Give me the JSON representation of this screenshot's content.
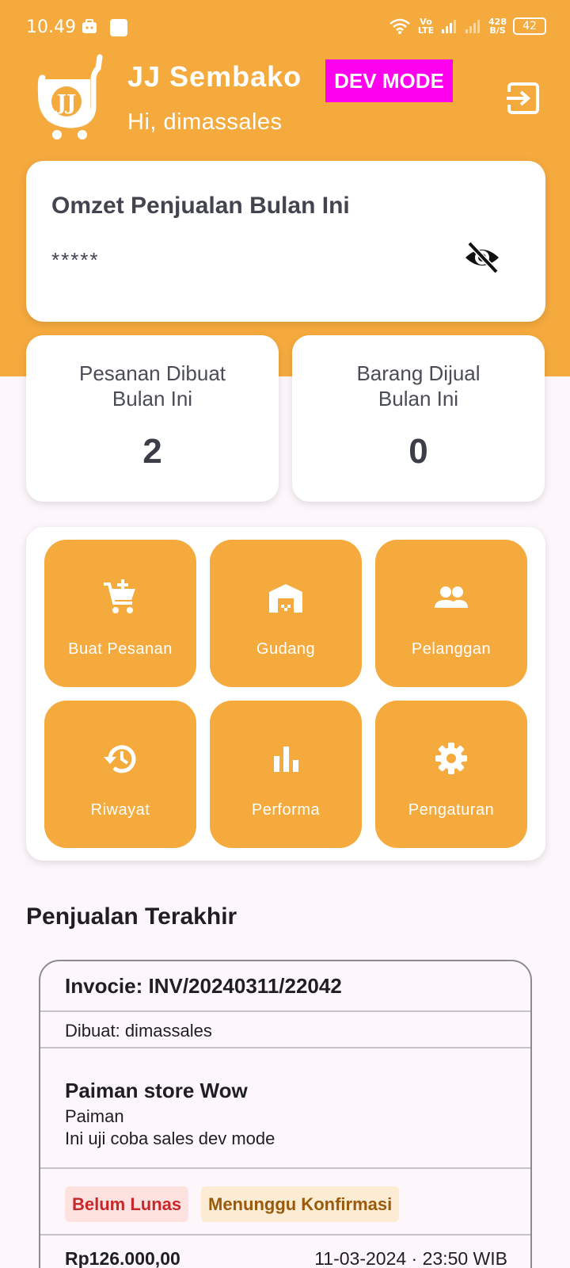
{
  "status_bar": {
    "time": "10.49",
    "network": "Vo LTE",
    "speed_value": "428",
    "speed_unit": "B/S",
    "battery": "42"
  },
  "header": {
    "app_title": "JJ Sembako",
    "dev_badge": "DEV MODE",
    "greeting": "Hi, dimassales",
    "logo_text": "JJ"
  },
  "omzet": {
    "title": "Omzet Penjualan Bulan Ini",
    "value": "*****"
  },
  "stats": [
    {
      "label_line1": "Pesanan Dibuat",
      "label_line2": "Bulan Ini",
      "value": "2"
    },
    {
      "label_line1": "Barang Dijual",
      "label_line2": "Bulan Ini",
      "value": "0"
    }
  ],
  "menu": {
    "items": [
      {
        "label": "Buat Pesanan",
        "icon": "add-cart-icon"
      },
      {
        "label": "Gudang",
        "icon": "warehouse-icon"
      },
      {
        "label": "Pelanggan",
        "icon": "people-icon"
      },
      {
        "label": "Riwayat",
        "icon": "history-icon"
      },
      {
        "label": "Performa",
        "icon": "bar-chart-icon"
      },
      {
        "label": "Pengaturan",
        "icon": "gear-icon"
      }
    ]
  },
  "recent_sales": {
    "title": "Penjualan Terakhir",
    "invoice": {
      "title": "Invocie: INV/20240311/22042",
      "created_by": "Dibuat: dimassales",
      "customer_name": "Paiman store Wow",
      "customer_contact": "Paiman",
      "note": "Ini uji coba sales dev mode",
      "badge_payment": "Belum Lunas",
      "badge_status": "Menunggu Konfirmasi",
      "total": "Rp126.000,00",
      "datetime": "11-03-2024 · 23:50 WIB"
    }
  },
  "colors": {
    "primary": "#f5aa3e",
    "dev_badge": "#ff00ee",
    "background": "#fdf7fb",
    "unpaid_text": "#c9282a",
    "waiting_text": "#9a5a0c"
  }
}
